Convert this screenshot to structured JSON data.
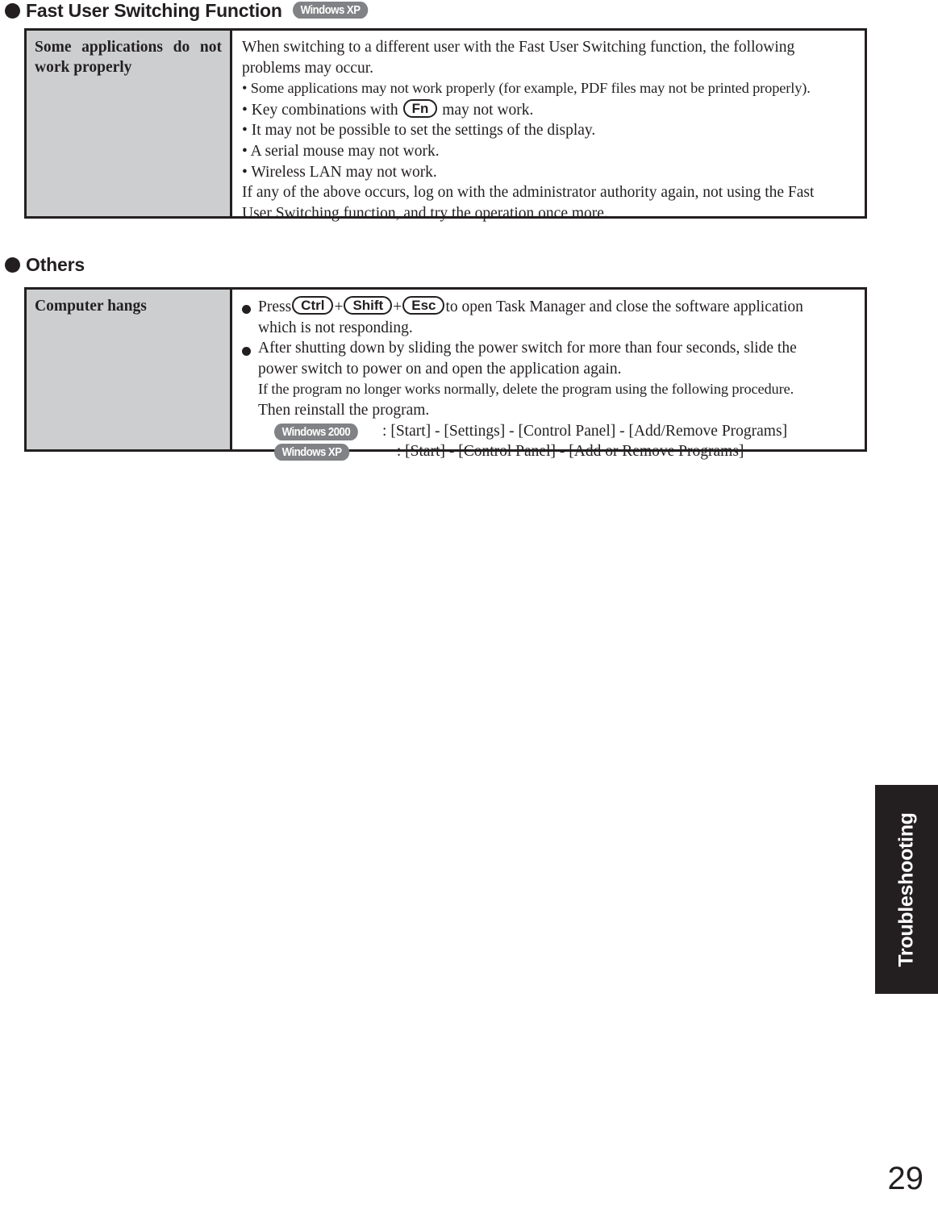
{
  "page": {
    "number": "29",
    "side_tab_label": "Troubleshooting"
  },
  "sections": [
    {
      "id": "fast-user-switching",
      "heading": "Fast User Switching Function",
      "heading_badge": "Windows XP",
      "table": {
        "label": "Some applications do not work properly",
        "label_line_1": "Some applications do not",
        "label_line_2": "work properly",
        "body": {
          "intro_line_1": "When switching to a different user with the Fast User Switching function, the following",
          "intro_line_2": "problems may occur.",
          "bullets": [
            "• Some applications may not work properly (for example, PDF files may not be printed properly).",
            "• Key combinations with",
            "• It may not be possible to set the settings of the display.",
            "• A serial mouse may not work.",
            "• Wireless LAN may not work."
          ],
          "bullet_fn_prefix": "• Key combinations with",
          "bullet_fn_key": "Fn",
          "bullet_fn_suffix": "may not work.",
          "closing_line_1": "If any of the above occurs, log on with the administrator authority again, not using the Fast",
          "closing_line_2": "User Switching function, and try the operation once more."
        }
      }
    },
    {
      "id": "others",
      "heading": "Others",
      "heading_badge": "",
      "table": {
        "label": "Computer hangs",
        "body": {
          "item1_press": "Press",
          "item1_key1": "Ctrl",
          "item1_plus1": "+",
          "item1_key2": "Shift",
          "item1_plus2": "+",
          "item1_key3": "Esc",
          "item1_tail": "to open Task Manager and close the software application",
          "item1_line2": "which is not responding.",
          "item2_line1": "After shutting down by sliding the power switch for more than four seconds, slide the",
          "item2_line2": "power switch to power on and open the application again.",
          "item2_line3": "If the program no longer works normally, delete the program using the following procedure.",
          "item2_line4": "Then reinstall the program.",
          "os_rows": [
            {
              "badge": "Windows 2000",
              "path": ": [Start] - [Settings] - [Control Panel] - [Add/Remove Programs]"
            },
            {
              "badge": "Windows XP",
              "path": ": [Start] - [Control Panel] - [Add or Remove Programs]"
            }
          ]
        }
      }
    }
  ],
  "colors": {
    "ink": "#231f20",
    "label_cell_bg": "#ccced0",
    "badge_bg": "#808285"
  }
}
